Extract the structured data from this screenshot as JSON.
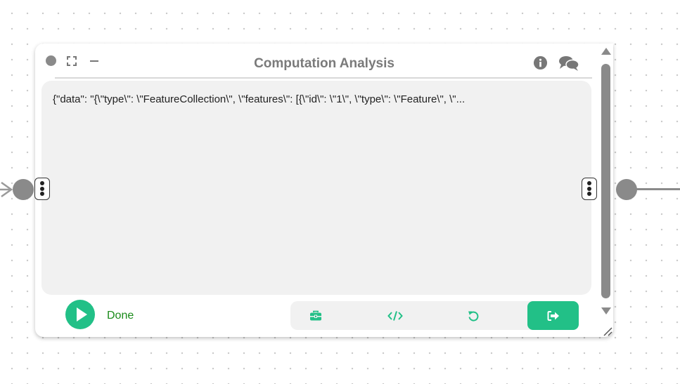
{
  "node": {
    "title": "Computation Analysis",
    "output_text": "{\"data\": \"{\\\"type\\\": \\\"FeatureCollection\\\", \\\"features\\\": [{\\\"id\\\": \\\"1\\\", \\\"type\\\": \\\"Feature\\\", \\\"...",
    "status": "Done"
  },
  "colors": {
    "accent": "#22c087",
    "status": "#1a8b1a",
    "port": "#8a8a8a"
  },
  "icons": {
    "window_dot": "circle-icon",
    "expand": "expand-icon",
    "minimize": "minus-icon",
    "info": "info-circle-icon",
    "chat": "comments-icon",
    "run": "play-icon",
    "toolbox": "toolbox-icon",
    "code": "code-icon",
    "reset": "undo-icon",
    "exit": "sign-out-icon",
    "resize": "resize-grip-icon"
  }
}
